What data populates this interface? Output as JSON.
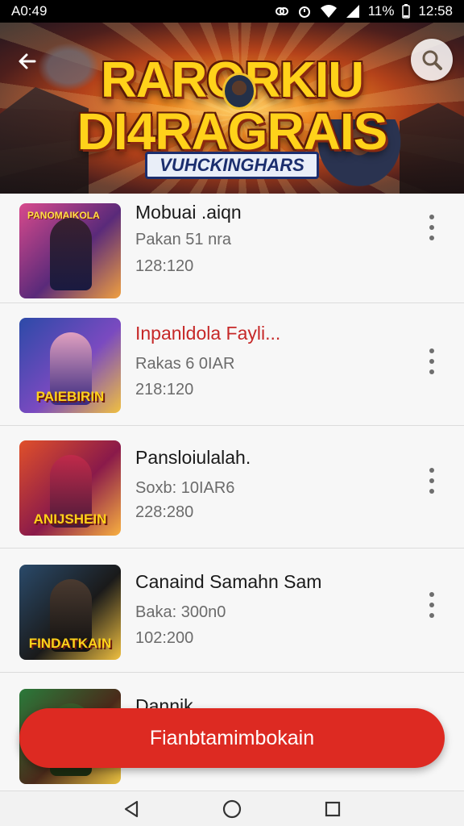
{
  "status_bar": {
    "left_text": "A0:49",
    "battery": "11%",
    "time": "12:58",
    "icons": [
      "link-icon",
      "alarm-icon",
      "wifi-icon",
      "signal-icon",
      "battery-icon"
    ]
  },
  "banner": {
    "title_line1": "RARORKIU",
    "title_line2": "DI4RAGRAIS",
    "subtitle": "VUHCKINGHARS",
    "back_icon": "back-arrow-icon",
    "search_icon": "search-icon",
    "colors": {
      "title": "#ffd21a",
      "outline": "#8a2a10"
    }
  },
  "list": {
    "items": [
      {
        "title": "Mobuai .aiqn",
        "subtitle": "Pakan 51 nra",
        "time": "128:120",
        "thumb_tag": "PANOMAIKOLA",
        "thumb_caption": "",
        "title_color": "default",
        "thumb_colors": [
          "#d84a8c",
          "#5a2a7a",
          "#f0a040"
        ]
      },
      {
        "title": "Inpanldola Fayli...",
        "subtitle": "Rakas 6 0IAR",
        "time": "218:120",
        "thumb_tag": "",
        "thumb_caption": "PAIEBIRIN",
        "title_color": "red",
        "thumb_colors": [
          "#2c4aa8",
          "#7a4ac0",
          "#f0c040"
        ]
      },
      {
        "title": "Pansloiulalah.",
        "subtitle": "Soxb: 10IAR6",
        "time": "228:280",
        "thumb_tag": "",
        "thumb_caption": "ANIJSHEIN",
        "title_color": "default",
        "thumb_colors": [
          "#e0502a",
          "#8a1a4a",
          "#f8b040"
        ]
      },
      {
        "title": "Canaind Samahn Sam",
        "subtitle": "Baka: 300n0",
        "time": "102:200",
        "thumb_tag": "",
        "thumb_caption": "FINDATKAIN",
        "title_color": "default",
        "thumb_colors": [
          "#2a4a6a",
          "#1a1a1a",
          "#f0c040"
        ]
      },
      {
        "title": "Dannik",
        "subtitle": "",
        "time": "",
        "thumb_tag": "",
        "thumb_caption": "",
        "title_color": "default",
        "thumb_colors": [
          "#2a7a3a",
          "#4a2a1a",
          "#e8c040"
        ]
      }
    ],
    "more_icon": "more-vertical-icon"
  },
  "cta": {
    "label": "Fianbtamimbokain",
    "color": "#dd2a22"
  },
  "nav_bar": {
    "icons": [
      "back-triangle-icon",
      "home-circle-icon",
      "recents-square-icon"
    ]
  }
}
